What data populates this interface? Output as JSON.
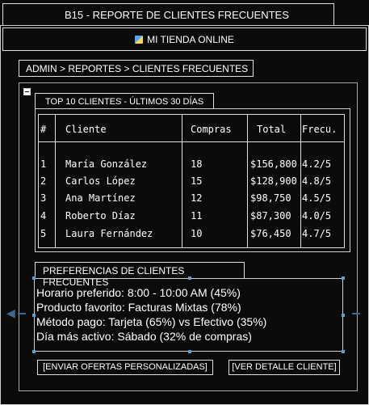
{
  "window": {
    "title": "B15 - REPORTE DE CLIENTES FRECUENTES"
  },
  "store": {
    "icon": "shopping-bag-icon",
    "name": "MI TIENDA ONLINE"
  },
  "breadcrumb": "ADMIN > REPORTES > CLIENTES FRECUENTES",
  "top_clients": {
    "tab_label": "TOP 10 CLIENTES - ÚLTIMOS 30 DÍAS",
    "headers": [
      "#",
      "Cliente",
      "Compras",
      "Total",
      "Frecu."
    ],
    "rows": [
      [
        "1",
        "María González",
        "18",
        "$156,800",
        "4.2/5"
      ],
      [
        "2",
        "Carlos López",
        "15",
        "$128,900",
        "4.8/5"
      ],
      [
        "3",
        "Ana Martínez",
        "12",
        "$98,750",
        "4.5/5"
      ],
      [
        "4",
        "Roberto Díaz",
        "11",
        "$87,300",
        "4.0/5"
      ],
      [
        "5",
        "Laura Fernández",
        "10",
        "$76,450",
        "4.7/5"
      ]
    ]
  },
  "preferences": {
    "tab_label": "PREFERENCIAS DE CLIENTES FRECUENTES",
    "lines": [
      "Horario preferido: 8:00 - 10:00 AM (45%)",
      "Producto favorito: Facturas Mixtas (78%)",
      "Método pago: Tarjeta (65%) vs Efectivo (35%)",
      "Día más activo: Sábado (32% de compras)"
    ]
  },
  "actions": {
    "send_offers": "[ENVIAR OFERTAS PERSONALIZADAS]",
    "view_detail": "[VER DETALLE CLIENTE]"
  },
  "colors": {
    "background": "#0b0b0b",
    "text": "#ffffff",
    "selection": "#4b86b4"
  }
}
